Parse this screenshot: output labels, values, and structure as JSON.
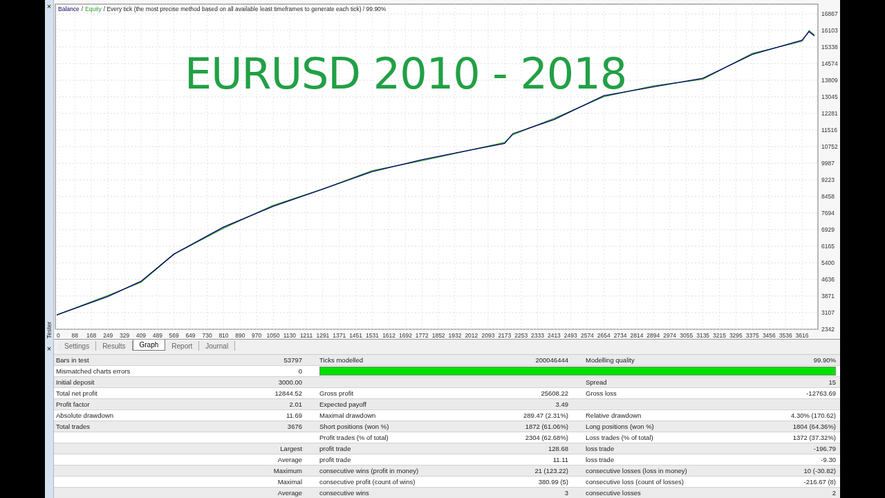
{
  "side_panel": {
    "label": "Tester",
    "close_marks": [
      "×",
      "×"
    ]
  },
  "chart": {
    "legend_separator": "/",
    "legend_rest": "/ Every tick (the most precise method based on all available least timeframes to generate each tick) / 99.90%",
    "overlay_title": "EURUSD 2010 - 2018",
    "chart_data": {
      "type": "line",
      "x": [
        0,
        249,
        409,
        569,
        810,
        1050,
        1291,
        1531,
        1772,
        2012,
        2173,
        2213,
        2413,
        2654,
        2894,
        3135,
        3375,
        3616,
        3650,
        3676
      ],
      "series": [
        {
          "name": "Balance",
          "color": "#000066",
          "values": [
            3000,
            3850,
            4550,
            5800,
            7050,
            8000,
            8800,
            9600,
            10150,
            10600,
            10900,
            11350,
            12000,
            13100,
            13500,
            13900,
            15000,
            15650,
            16050,
            15850
          ]
        },
        {
          "name": "Equity",
          "color": "#2e9e2e",
          "values": [
            3000,
            3900,
            4500,
            5800,
            7000,
            8050,
            8800,
            9650,
            10100,
            10600,
            10950,
            11300,
            12050,
            13050,
            13550,
            13850,
            15050,
            15600,
            16100,
            15900
          ]
        }
      ],
      "grid": true,
      "xlim": [
        0,
        3693
      ],
      "ylim": [
        2342,
        17313
      ],
      "xticks": [
        0,
        88,
        168,
        249,
        329,
        409,
        489,
        569,
        649,
        730,
        810,
        890,
        970,
        1050,
        1130,
        1211,
        1291,
        1371,
        1451,
        1531,
        1612,
        1692,
        1772,
        1852,
        1932,
        2012,
        2093,
        2173,
        2253,
        2333,
        2413,
        2493,
        2574,
        2654,
        2734,
        2814,
        2894,
        2974,
        3055,
        3135,
        3215,
        3295,
        3375,
        3456,
        3536,
        3616
      ],
      "yticks": [
        2342,
        3107,
        3871,
        4636,
        5400,
        6165,
        6929,
        7694,
        8458,
        9223,
        9987,
        10752,
        11516,
        12281,
        13045,
        13809,
        14574,
        15338,
        16103,
        16867
      ]
    }
  },
  "tabs": [
    {
      "label": "Settings",
      "selected": false
    },
    {
      "label": "Results",
      "selected": false
    },
    {
      "label": "Graph",
      "selected": true
    },
    {
      "label": "Report",
      "selected": false
    },
    {
      "label": "Journal",
      "selected": false
    }
  ],
  "report": {
    "rows": [
      {
        "kind": "cells",
        "cells": [
          "Bars in test",
          "53797",
          "Ticks modelled",
          "200046444",
          "Modelling quality",
          "99.90%"
        ]
      },
      {
        "kind": "bar",
        "cells": [
          "Mismatched charts errors",
          "0"
        ]
      },
      {
        "kind": "cells",
        "cells": [
          "Initial deposit",
          "3000.00",
          null,
          null,
          "Spread",
          "15"
        ]
      },
      {
        "kind": "cells",
        "cells": [
          "Total net profit",
          "12844.52",
          "Gross profit",
          "25608.22",
          "Gross loss",
          "-12763.69"
        ]
      },
      {
        "kind": "cells",
        "cells": [
          "Profit factor",
          "2.01",
          "Expected payoff",
          "3.49",
          null,
          null
        ]
      },
      {
        "kind": "cells",
        "cells": [
          "Absolute drawdown",
          "11.69",
          "Maximal drawdown",
          "289.47 (2.31%)",
          "Relative drawdown",
          "4.30% (170.62)"
        ]
      },
      {
        "kind": "cells",
        "cells": [
          "Total trades",
          "3676",
          "Short positions (won %)",
          "1872 (61.06%)",
          "Long positions (won %)",
          "1804 (64.36%)"
        ]
      },
      {
        "kind": "cells",
        "cells": [
          null,
          null,
          "Profit trades (% of total)",
          "2304 (62.68%)",
          "Loss trades (% of total)",
          "1372 (37.32%)"
        ]
      },
      {
        "kind": "cells",
        "cells": [
          null,
          "Largest",
          "profit trade",
          "128.68",
          "loss trade",
          "-196.79"
        ]
      },
      {
        "kind": "cells",
        "cells": [
          null,
          "Average",
          "profit trade",
          "11.11",
          "loss trade",
          "-9.30"
        ]
      },
      {
        "kind": "cells",
        "cells": [
          null,
          "Maximum",
          "consecutive wins (profit in money)",
          "21 (123.22)",
          "consecutive losses (loss in money)",
          "10 (-30.82)"
        ]
      },
      {
        "kind": "cells",
        "cells": [
          null,
          "Maximal",
          "consecutive profit (count of wins)",
          "380.99 (5)",
          "consecutive loss (count of losses)",
          "-216.67 (8)"
        ]
      },
      {
        "kind": "cells",
        "cells": [
          null,
          "Average",
          "consecutive wins",
          "3",
          "consecutive losses",
          "2"
        ]
      }
    ]
  }
}
